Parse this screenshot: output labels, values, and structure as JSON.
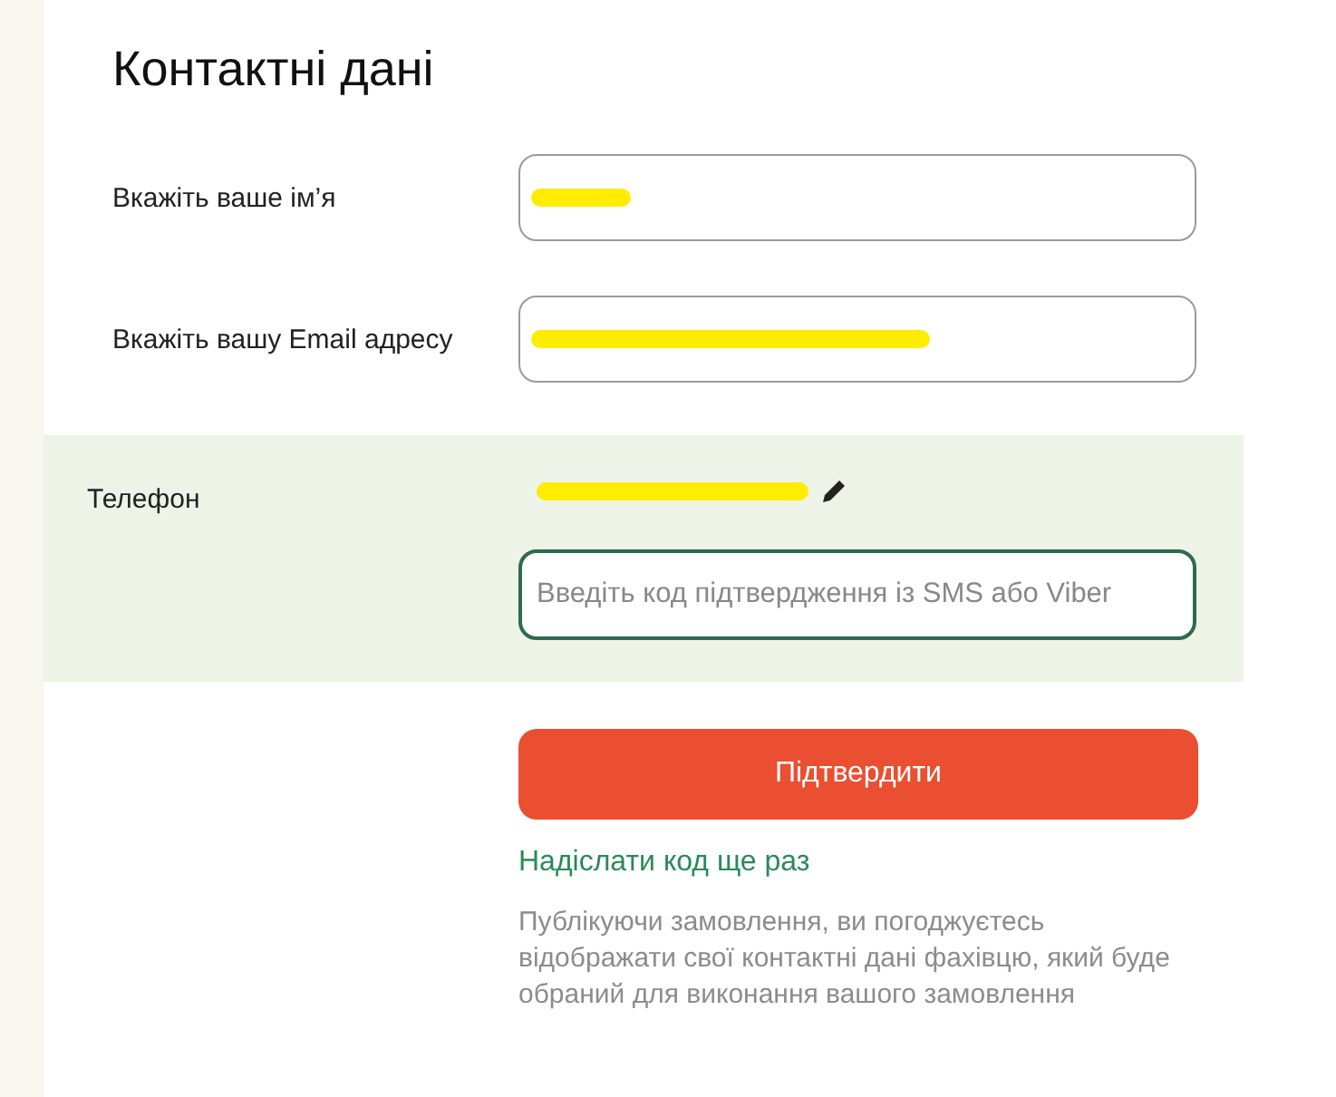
{
  "title": "Контактні дані",
  "fields": [
    {
      "label": "Вкажіть ваше ім’я",
      "redacted": true
    },
    {
      "label": "Вкажіть вашу Email адресу",
      "redacted": true
    }
  ],
  "phone": {
    "label": "Телефон",
    "redacted": true,
    "code_field": {
      "placeholder": "Введіть код підтвердження із SMS або Viber",
      "focused": true
    }
  },
  "confirm_button": "Підтвердити",
  "resend_link": "Надіслати код ще раз",
  "note": "Публікуючи замовлення, ви погоджуєтесь відображати свої контактні дані фахівцю, який буде обраний для виконання вашого замовлення"
}
